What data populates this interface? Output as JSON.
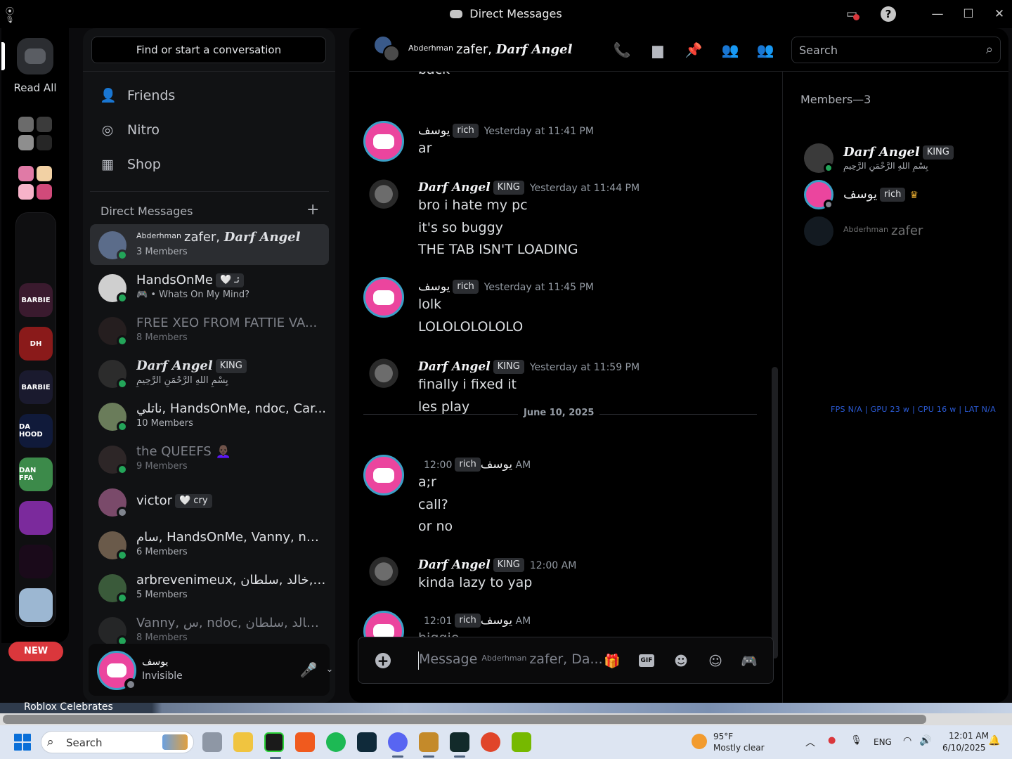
{
  "window": {
    "title": "Direct Messages"
  },
  "rail": {
    "read_all": "Read All",
    "servers": [
      {
        "name": "server-barbie-1",
        "label": "BARBIE",
        "color": "#3a1a2e"
      },
      {
        "name": "server-dh",
        "label": "DH",
        "color": "#8a1a1a"
      },
      {
        "name": "server-barbie-2",
        "label": "BARBIE",
        "color": "#1a1a2e"
      },
      {
        "name": "server-da-hood",
        "label": "DA HOOD",
        "color": "#101a3a"
      },
      {
        "name": "server-dan-ffa",
        "label": "DAN FFA",
        "color": "#3c8a4a"
      },
      {
        "name": "server-neon",
        "label": "",
        "color": "#7b2a9c"
      },
      {
        "name": "server-cards",
        "label": "",
        "color": "#1a0a1a"
      },
      {
        "name": "server-city",
        "label": "",
        "color": "#9cb7d2"
      }
    ],
    "new_badge": "NEW"
  },
  "dm": {
    "search_placeholder": "Find or start a conversation",
    "nav": [
      {
        "label": "Friends",
        "icon": "friends-icon"
      },
      {
        "label": "Nitro",
        "icon": "nitro-icon"
      },
      {
        "label": "Shop",
        "icon": "shop-icon"
      }
    ],
    "header": "Direct Messages",
    "items": [
      {
        "prefix": "Abderhman",
        "name": "zafer, ",
        "gothic": "Darf Angel",
        "sub": "3 Members",
        "dim": false,
        "active": true,
        "status": "online"
      },
      {
        "prefix": "",
        "name": "HandsOnMe",
        "gothic": "",
        "tag": "🤍 ئـ",
        "sub": "🎮 • Whats On My Mind?",
        "dim": false,
        "active": false,
        "status": "online"
      },
      {
        "prefix": "",
        "name": "FREE XEO FROM FATTIE VA...",
        "gothic": "",
        "sub": "8 Members",
        "dim": true,
        "active": false,
        "status": "online"
      },
      {
        "prefix": "",
        "name": "",
        "gothic": "Darf Angel",
        "tag": "KING",
        "sub": "بِسْمِ اللهِ الرَّحْمَنِ الرَّحِيمِ",
        "dim": false,
        "active": false,
        "status": "online"
      },
      {
        "prefix": "",
        "name": "ناتلي, HandsOnMe, ndoc, Car...",
        "gothic": "",
        "sub": "10 Members",
        "dim": false,
        "active": false,
        "status": "online"
      },
      {
        "prefix": "",
        "name": "the QUEEFS 👩🏿‍🦲",
        "gothic": "",
        "sub": "9 Members",
        "dim": true,
        "active": false,
        "status": "online"
      },
      {
        "prefix": "",
        "name": "victor",
        "gothic": "",
        "tag": "🤍 cry",
        "sub": "",
        "dim": false,
        "active": false,
        "status": "offline"
      },
      {
        "prefix": "",
        "name": "سام, HandsOnMe, Vanny, nd...",
        "gothic": "",
        "sub": "6 Members",
        "dim": false,
        "active": false,
        "status": "online"
      },
      {
        "prefix": "",
        "name": "arbrevenimeux, خالد ,سلطان, r...",
        "gothic": "",
        "sub": "5 Members",
        "dim": false,
        "active": false,
        "status": "online"
      },
      {
        "prefix": "",
        "name": "Vanny, س, ndoc, خالد ,سلطان, v...",
        "gothic": "",
        "sub": "8 Members",
        "dim": true,
        "active": false,
        "status": "online"
      }
    ]
  },
  "user": {
    "name": "يوسف",
    "status": "Invisible"
  },
  "chat": {
    "header": {
      "prefix": "Abderhman",
      "name": "zafer, ",
      "gothic": "Darf Angel"
    },
    "search_placeholder": "Search",
    "partial_top": "back",
    "messages": [
      {
        "author": "يوسف",
        "gothic": false,
        "tag": "rich",
        "time": "Yesterday at 11:41 PM",
        "lines": [
          "ar"
        ],
        "avatar": "pink"
      },
      {
        "author": "Darf Angel",
        "gothic": true,
        "tag": "KING",
        "time": "Yesterday at 11:44 PM",
        "lines": [
          "bro i hate my pc",
          "it's so buggy",
          "THE TAB ISN'T LOADING"
        ],
        "avatar": "skull"
      },
      {
        "author": "يوسف",
        "gothic": false,
        "tag": "rich",
        "time": "Yesterday at 11:45 PM",
        "lines": [
          "lolk",
          "LOLOLOLOLOLO"
        ],
        "avatar": "pink"
      },
      {
        "author": "Darf Angel",
        "gothic": true,
        "tag": "KING",
        "time": "Yesterday at 11:59 PM",
        "lines": [
          "finally i fixed it",
          "les play"
        ],
        "avatar": "skull"
      },
      {
        "author": "يوسف",
        "gothic": false,
        "tag": "rich",
        "time": "12:00 AM",
        "lines": [
          "a;r",
          "call?",
          "or no"
        ],
        "avatar": "pink"
      },
      {
        "author": "Darf Angel",
        "gothic": true,
        "tag": "KING",
        "time": "12:00 AM",
        "lines": [
          "kinda lazy to yap"
        ],
        "avatar": "skull"
      },
      {
        "author": "يوسف",
        "gothic": false,
        "tag": "rich",
        "time": "12:01 AM",
        "lines": [
          "biggie"
        ],
        "avatar": "pink"
      }
    ],
    "date_divider": "June 10, 2025",
    "composer_placeholder_prefix": "Message",
    "composer_placeholder_small": "Abderhman",
    "composer_placeholder_rest": "zafer, Da..."
  },
  "members": {
    "header": "Members—3",
    "list": [
      {
        "name": "Darf Angel",
        "gothic": true,
        "tag": "KING",
        "sub": "بِسْمِ اللهِ الرَّحْمَنِ الرَّحِيمِ",
        "status": "online"
      },
      {
        "name": "يوسف",
        "gothic": false,
        "tag": "rich",
        "sub": "",
        "status": "offline",
        "owner": true
      },
      {
        "name": "zafer",
        "prefix": "Abderhman",
        "gothic": false,
        "tag": "",
        "sub": "",
        "status": "offline",
        "dim": true
      }
    ],
    "perf": "FPS N/A  |  GPU 23 w  |  CPU 16 w  |  LAT N/A"
  },
  "background": {
    "text": "Roblox Celebrates"
  },
  "taskbar": {
    "search_placeholder": "Search",
    "weather_temp": "95°F",
    "weather_desc": "Mostly clear",
    "lang": "ENG",
    "time": "12:01 AM",
    "date": "6/10/2025"
  }
}
